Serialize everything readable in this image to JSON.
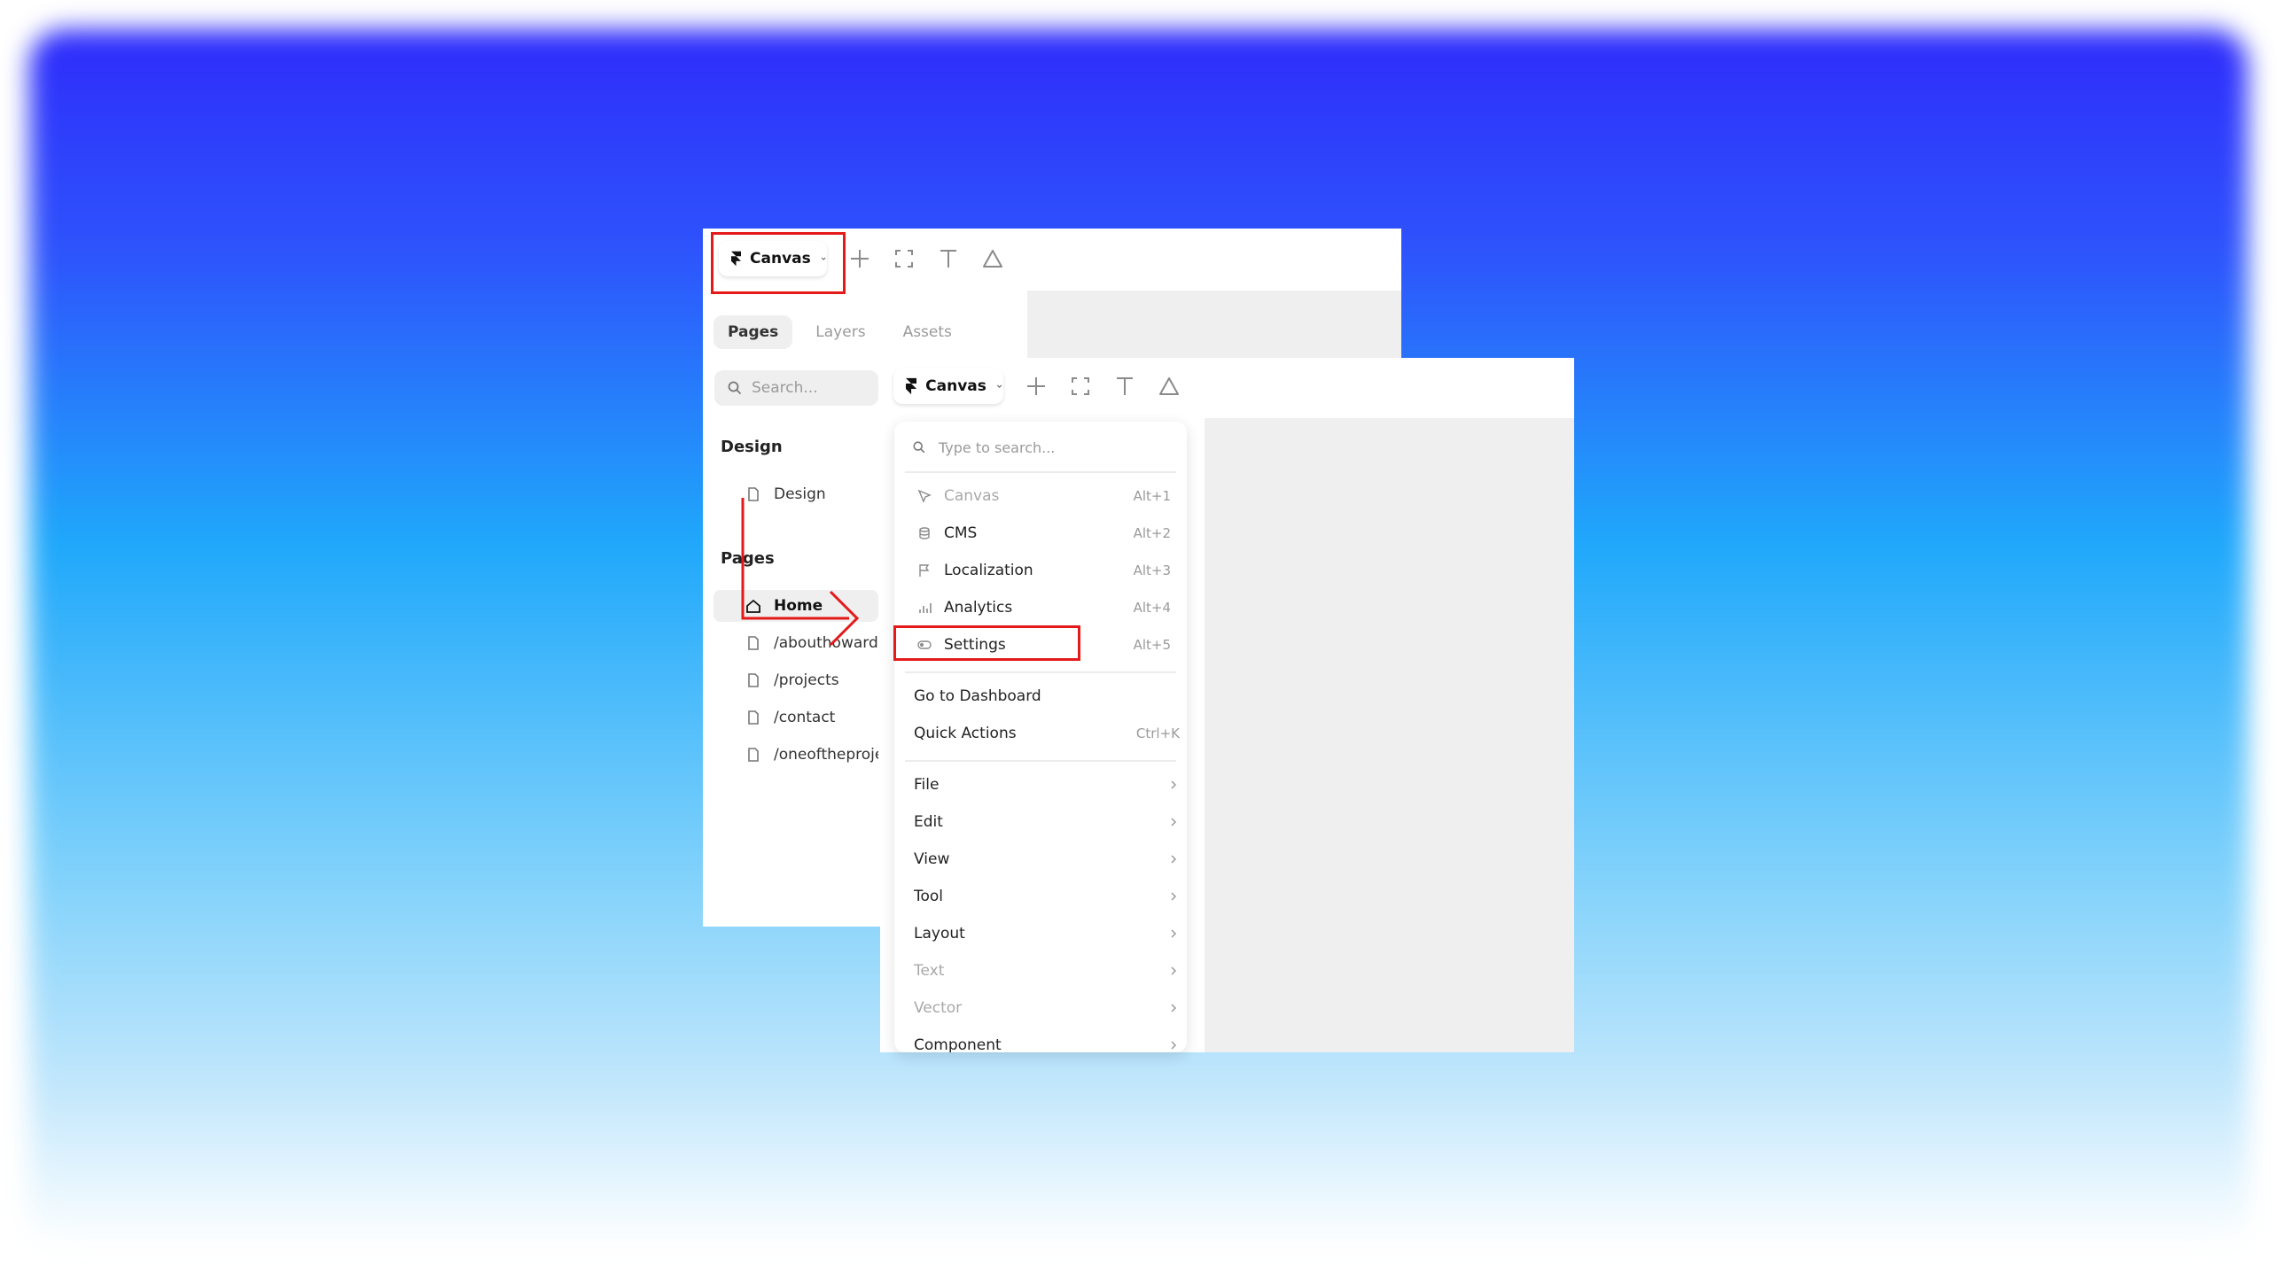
{
  "back_window": {
    "canvas_button": "Canvas",
    "tabs": [
      {
        "label": "Pages",
        "active": true
      },
      {
        "label": "Layers",
        "active": false
      },
      {
        "label": "Assets",
        "active": false
      }
    ],
    "search_placeholder": "Search...",
    "design_section": "Design",
    "design_items": [
      "Design"
    ],
    "pages_section": "Pages",
    "pages": [
      {
        "label": "Home",
        "icon": "home-icon",
        "active": true
      },
      {
        "label": "/abouthoward",
        "icon": "page-icon",
        "active": false
      },
      {
        "label": "/projects",
        "icon": "page-icon",
        "active": false
      },
      {
        "label": "/contact",
        "icon": "page-icon",
        "active": false
      },
      {
        "label": "/oneoftheproje",
        "icon": "page-icon",
        "active": false
      }
    ]
  },
  "front_window": {
    "canvas_button": "Canvas",
    "menu": {
      "search_placeholder": "Type to search...",
      "modes": [
        {
          "label": "Canvas",
          "shortcut": "Alt+1",
          "icon": "cursor-icon",
          "dim": true
        },
        {
          "label": "CMS",
          "shortcut": "Alt+2",
          "icon": "database-icon",
          "dim": false
        },
        {
          "label": "Localization",
          "shortcut": "Alt+3",
          "icon": "flag-icon",
          "dim": false
        },
        {
          "label": "Analytics",
          "shortcut": "Alt+4",
          "icon": "bar-chart-icon",
          "dim": false
        },
        {
          "label": "Settings",
          "shortcut": "Alt+5",
          "icon": "toggle-icon",
          "dim": false
        }
      ],
      "actions": [
        {
          "label": "Go to Dashboard",
          "shortcut": ""
        },
        {
          "label": "Quick Actions",
          "shortcut": "Ctrl+K"
        }
      ],
      "submenus": [
        {
          "label": "File",
          "dim": false
        },
        {
          "label": "Edit",
          "dim": false
        },
        {
          "label": "View",
          "dim": false
        },
        {
          "label": "Tool",
          "dim": false
        },
        {
          "label": "Layout",
          "dim": false
        },
        {
          "label": "Text",
          "dim": true
        },
        {
          "label": "Vector",
          "dim": true
        },
        {
          "label": "Component",
          "dim": false
        }
      ]
    }
  },
  "colors": {
    "annotation": "#e41919",
    "panel_gray": "#efefef"
  }
}
